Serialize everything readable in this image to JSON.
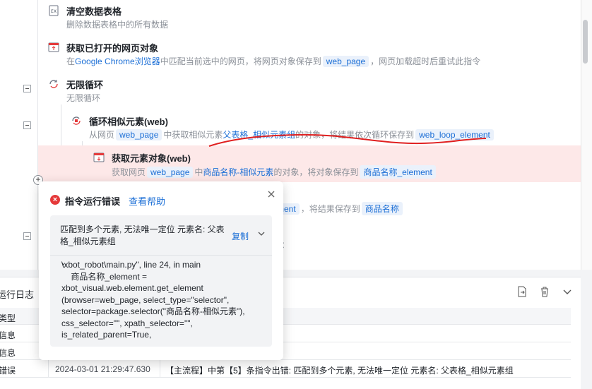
{
  "flow": {
    "commands": [
      {
        "title": "清空数据表格",
        "desc": "删除数据表格中的所有数据"
      },
      {
        "title": "获取已打开的网页对象",
        "desc_parts": [
          "在",
          "Google Chrome浏览器",
          "中匹配当前选中的网页，将网页对象保存到",
          "web_page",
          "，网页加载超时后重试此指令"
        ]
      },
      {
        "title": "无限循环",
        "desc": "无限循环"
      },
      {
        "title": "循环相似元素(web)",
        "desc_parts": [
          "从网页",
          "web_page",
          "中获取相似元素",
          "父表格_相似元素组",
          "的对象，将结果依次循环保存到",
          "web_loop_element"
        ]
      },
      {
        "title": "获取元素对象(web)",
        "desc_parts": [
          "获取网页",
          "web_page",
          "中",
          "商品名称-相似元素",
          "的对象，将对象保存到",
          "商品名称_element"
        ]
      },
      {
        "desc_parts": [
          "ment",
          "，将结果保存到",
          "商品名称"
        ]
      }
    ],
    "partial_text_right": "："
  },
  "popup": {
    "title": "指令运行错误",
    "help_link": "查看帮助",
    "message": "匹配到多个元素, 无法唯一定位 元素名: 父表格_相似元素组",
    "copy_label": "复制",
    "trace_lead": "、",
    "trace": "\\xbot_robot\\main.py\", line 24, in main\n    商品名称_element =\nxbot_visual.web.element.get_element\n(browser=web_page, select_type=\"selector\",\nselector=package.selector(\"商品名称-相似元素\"),\ncss_selector=\"\", xpath_selector=\"\",\nis_related_parent=True,"
  },
  "log": {
    "title": "运行日志",
    "header_type": "类型",
    "rows": [
      {
        "type": "信息",
        "time": "",
        "content": ""
      },
      {
        "type": "信息",
        "time": "",
        "content": ""
      },
      {
        "type": "错误",
        "time": "2024-03-01 21:29:47.630",
        "content": "【主流程】中第【5】条指令出错: 匹配到多个元素, 无法唯一定位 元素名: 父表格_相似元素组"
      }
    ]
  },
  "colors": {
    "accent": "#1c6fd6",
    "error": "#e5393a",
    "error_row": "#fde8e8",
    "annotation": "#e02020"
  }
}
